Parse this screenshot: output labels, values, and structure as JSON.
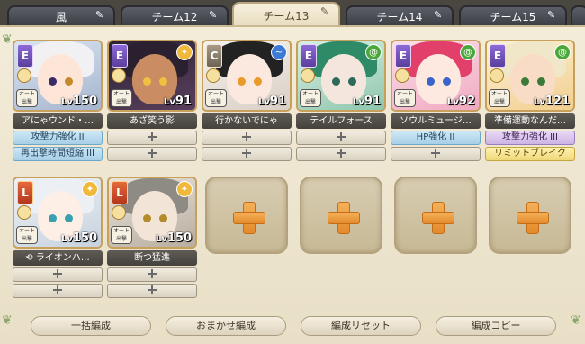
{
  "tabs": [
    {
      "label": "風"
    },
    {
      "label": "チーム12"
    },
    {
      "label": "チーム13"
    },
    {
      "label": "チーム14"
    },
    {
      "label": "チーム15"
    }
  ],
  "badge_text": "オート\n出撃",
  "cards": [
    {
      "rarity": "E",
      "element": "",
      "level": "150",
      "name": "アにゃウンド・…",
      "slot1": "攻撃力強化 II",
      "slot1_style": "blue",
      "slot2": "再出撃時間短縮 III",
      "slot2_style": "blue"
    },
    {
      "rarity": "E",
      "element": "",
      "level": "91",
      "name": "あざ笑う影",
      "slot1": "",
      "slot2": ""
    },
    {
      "rarity": "C",
      "element": "",
      "level": "91",
      "name": "行かないでにゃ",
      "slot1": "",
      "slot2": ""
    },
    {
      "rarity": "E",
      "element": "",
      "level": "91",
      "name": "テイルフォース",
      "slot1": "",
      "slot2": ""
    },
    {
      "rarity": "E",
      "element": "",
      "level": "92",
      "name": "ソウルミュージ…",
      "slot1": "HP強化 II",
      "slot1_style": "blue",
      "slot2": ""
    },
    {
      "rarity": "E",
      "element": "",
      "level": "121",
      "name": "準備運動なんだ…",
      "slot1": "攻撃力強化 III",
      "slot1_style": "purple",
      "slot2": "リミットブレイク",
      "slot2_style": "yellow"
    },
    {
      "rarity": "L",
      "element": "",
      "level": "150",
      "name": "ライオンハ…",
      "slot1": "",
      "slot2": ""
    },
    {
      "rarity": "L",
      "element": "",
      "level": "150",
      "name": "断つ猛進",
      "slot1": "",
      "slot2": ""
    }
  ],
  "lv_prefix": "Lv",
  "buttons": {
    "bulk": "一括編成",
    "auto": "おまかせ編成",
    "reset": "編成リセット",
    "copy": "編成コピー"
  },
  "colors": {
    "accent": "#e38a2a",
    "panel": "#f3ecd9"
  }
}
